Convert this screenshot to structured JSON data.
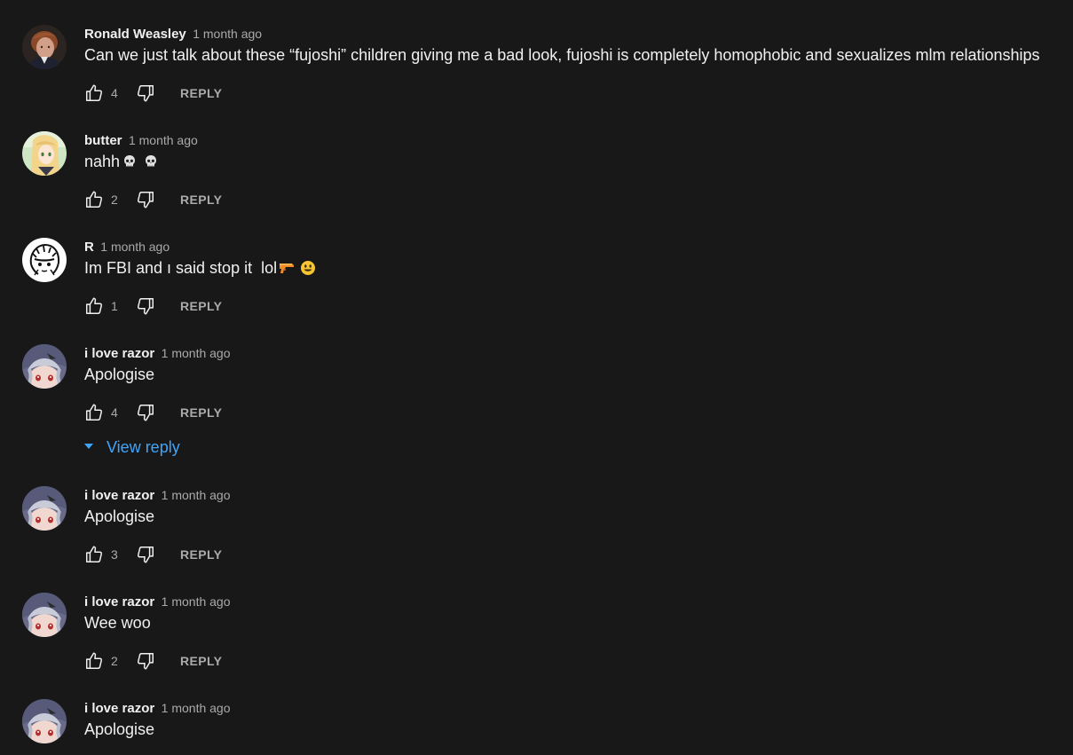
{
  "comments": [
    {
      "author": "Ronald Weasley",
      "time": "1 month ago",
      "text": "Can we just talk about these “fujoshi” children giving me a bad look, fujoshi is completely homophobic and sexualizes mlm relationships",
      "likes": "4",
      "reply_label": "REPLY"
    },
    {
      "author": "butter",
      "time": "1 month ago",
      "text": "nahh",
      "likes": "2",
      "reply_label": "REPLY"
    },
    {
      "author": "R",
      "time": "1 month ago",
      "text": "Im FBI and ı said stop it  lol",
      "likes": "1",
      "reply_label": "REPLY"
    },
    {
      "author": "i love razor",
      "time": "1 month ago",
      "text": "Apologise",
      "likes": "4",
      "reply_label": "REPLY"
    },
    {
      "author": "i love razor",
      "time": "1 month ago",
      "text": "Apologise",
      "likes": "3",
      "reply_label": "REPLY"
    },
    {
      "author": "i love razor",
      "time": "1 month ago",
      "text": "Wee woo",
      "likes": "2",
      "reply_label": "REPLY"
    },
    {
      "author": "i love razor",
      "time": "1 month ago",
      "text": "Apologise",
      "likes": "",
      "reply_label": ""
    }
  ],
  "view_reply_label": "View reply",
  "colors": {
    "background": "#181818",
    "primary_text": "#f1f1f1",
    "secondary_text": "#aaaaaa",
    "link": "#3ea6ff"
  },
  "icons": {
    "like": "thumbs-up-icon",
    "dislike": "thumbs-down-icon",
    "expand": "caret-down-icon",
    "emoji_skull": "skull-emoji-icon",
    "emoji_gun": "water-pistol-emoji-icon",
    "emoji_smile": "smiley-emoji-icon"
  }
}
